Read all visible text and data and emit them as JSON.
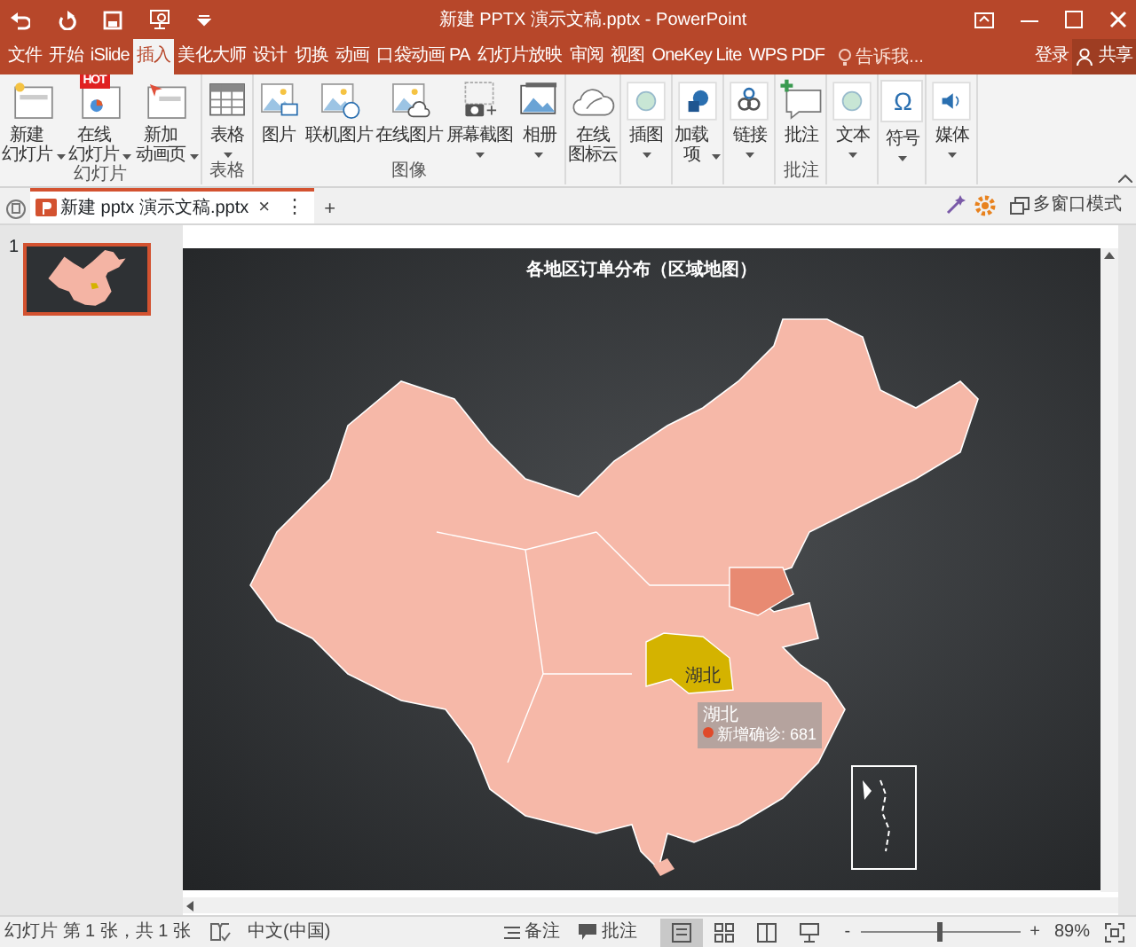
{
  "window": {
    "title": "新建 PPTX 演示文稿.pptx - PowerPoint"
  },
  "tabs": [
    {
      "label": "文件",
      "selected": false
    },
    {
      "label": "开始",
      "selected": false
    },
    {
      "label": "iSlide",
      "selected": false
    },
    {
      "label": "插入",
      "selected": true
    },
    {
      "label": "美化大师",
      "selected": false
    },
    {
      "label": "设计",
      "selected": false
    },
    {
      "label": "切换",
      "selected": false
    },
    {
      "label": "动画",
      "selected": false
    },
    {
      "label": "口袋动画 PA",
      "selected": false
    },
    {
      "label": "幻灯片放映",
      "selected": false
    },
    {
      "label": "审阅",
      "selected": false
    },
    {
      "label": "视图",
      "selected": false
    },
    {
      "label": "OneKey Lite",
      "selected": false
    },
    {
      "label": "WPS PDF",
      "selected": false
    }
  ],
  "tell_me": {
    "placeholder": "告诉我..."
  },
  "account": {
    "login": "登录",
    "share": "共享"
  },
  "ribbon": {
    "groups": [
      {
        "label": "幻灯片",
        "buttons": [
          {
            "lines": [
              "新建",
              "幻灯片"
            ],
            "dropdown": true
          },
          {
            "lines": [
              "在线",
              "幻灯片"
            ],
            "dropdown": true,
            "badge": "HOT"
          },
          {
            "lines": [
              "新加",
              "动画页"
            ],
            "dropdown": true
          }
        ]
      },
      {
        "label": "表格",
        "buttons": [
          {
            "lines": [
              "表格"
            ],
            "dropdown": true
          }
        ]
      },
      {
        "label": "图像",
        "buttons": [
          {
            "lines": [
              "图片"
            ],
            "dropdown": false
          },
          {
            "lines": [
              "联机图片"
            ],
            "dropdown": false
          },
          {
            "lines": [
              "在线图片"
            ],
            "dropdown": false
          },
          {
            "lines": [
              "屏幕截图"
            ],
            "dropdown": true
          },
          {
            "lines": [
              "相册"
            ],
            "dropdown": true
          }
        ]
      },
      {
        "buttons": [
          {
            "lines": [
              "在线",
              "图标云"
            ],
            "dropdown": false
          }
        ]
      },
      {
        "buttons": [
          {
            "lines": [
              "插图"
            ],
            "dropdown": true
          }
        ]
      },
      {
        "buttons": [
          {
            "lines": [
              "加载",
              "项"
            ],
            "dropdown": true
          }
        ]
      },
      {
        "buttons": [
          {
            "lines": [
              "链接"
            ],
            "dropdown": true
          }
        ]
      },
      {
        "label": "批注",
        "buttons": [
          {
            "lines": [
              "批注"
            ],
            "dropdown": false
          }
        ]
      },
      {
        "buttons": [
          {
            "lines": [
              "文本"
            ],
            "dropdown": true
          }
        ]
      },
      {
        "buttons": [
          {
            "lines": [
              "符号"
            ],
            "dropdown": true,
            "glyph": "Ω"
          }
        ]
      },
      {
        "buttons": [
          {
            "lines": [
              "媒体"
            ],
            "dropdown": true
          }
        ]
      }
    ]
  },
  "document_tab": {
    "title": "新建 pptx 演示文稿.pptx",
    "close": "×",
    "more": "⋮",
    "add": "+"
  },
  "multi_window": "多窗口模式",
  "slides": [
    {
      "number": "1",
      "selected": true
    }
  ],
  "slide": {
    "title": "各地区订单分布（区域地图）",
    "map": {
      "highlight_label": "湖北",
      "tooltip": {
        "title": "湖北",
        "text": "新增确诊: 681"
      }
    }
  },
  "status_bar": {
    "slide_info": "幻灯片 第 1 张，共 1 张",
    "language": "中文(中国)",
    "notes": "备注",
    "comments": "批注",
    "views": [
      {
        "selected": true
      },
      {
        "selected": false
      },
      {
        "selected": false
      },
      {
        "selected": false
      }
    ],
    "zoom_out": "-",
    "zoom_in": "+",
    "zoom": {
      "level": 0.5
    },
    "zoom_reading": "89%"
  }
}
